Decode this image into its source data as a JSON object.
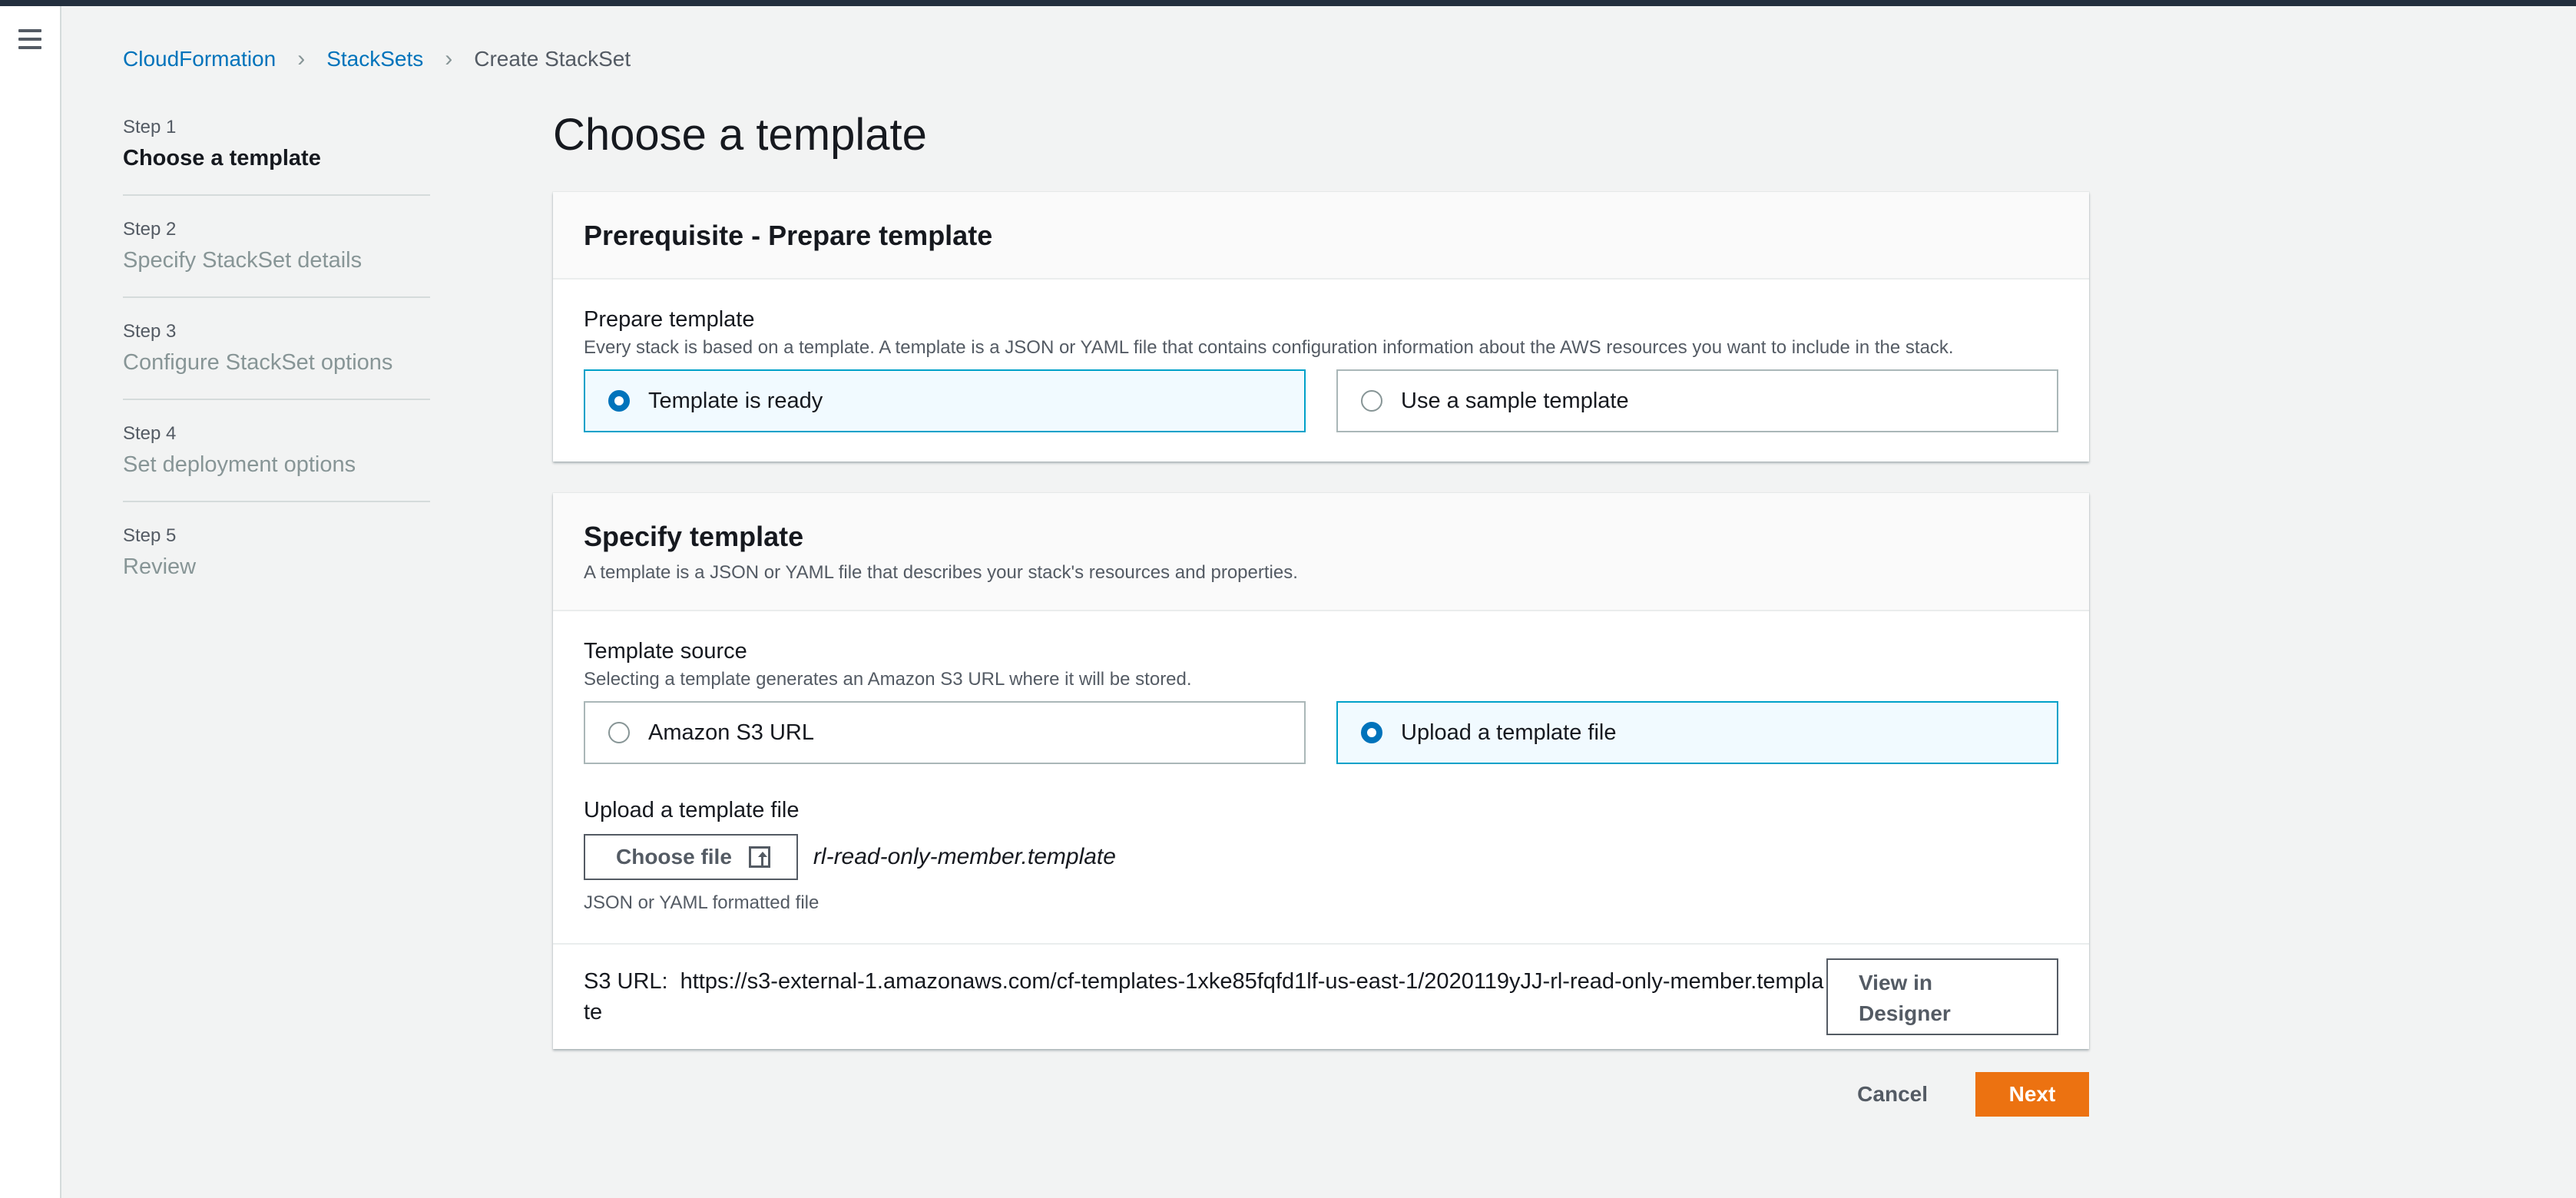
{
  "breadcrumb": {
    "items": [
      "CloudFormation",
      "StackSets"
    ],
    "current": "Create StackSet"
  },
  "steps": [
    {
      "num": "Step 1",
      "label": "Choose a template",
      "active": true
    },
    {
      "num": "Step 2",
      "label": "Specify StackSet details",
      "active": false
    },
    {
      "num": "Step 3",
      "label": "Configure StackSet options",
      "active": false
    },
    {
      "num": "Step 4",
      "label": "Set deployment options",
      "active": false
    },
    {
      "num": "Step 5",
      "label": "Review",
      "active": false
    }
  ],
  "page_title": "Choose a template",
  "prerequisite": {
    "title": "Prerequisite - Prepare template",
    "field_label": "Prepare template",
    "field_desc": "Every stack is based on a template. A template is a JSON or YAML file that contains configuration information about the AWS resources you want to include in the stack.",
    "options": [
      "Template is ready",
      "Use a sample template"
    ],
    "selected": "Template is ready"
  },
  "specify": {
    "title": "Specify template",
    "desc": "A template is a JSON or YAML file that describes your stack's resources and properties.",
    "source_label": "Template source",
    "source_desc": "Selecting a template generates an Amazon S3 URL where it will be stored.",
    "options": [
      "Amazon S3 URL",
      "Upload a template file"
    ],
    "selected": "Upload a template file",
    "upload_label": "Upload a template file",
    "choose_file_label": "Choose file",
    "filename": "rl-read-only-member.template",
    "upload_hint": "JSON or YAML formatted file",
    "s3_key": "S3 URL:",
    "s3_url": "https://s3-external-1.amazonaws.com/cf-templates-1xke85fqfd1lf-us-east-1/2020119yJJ-rl-read-only-member.template",
    "view_designer_label": "View in Designer"
  },
  "actions": {
    "cancel_label": "Cancel",
    "next_label": "Next"
  },
  "colors": {
    "accent": "#0073bb",
    "selected_border": "#00a1c9",
    "primary_button": "#ec7211",
    "topbar": "#232f3e"
  }
}
